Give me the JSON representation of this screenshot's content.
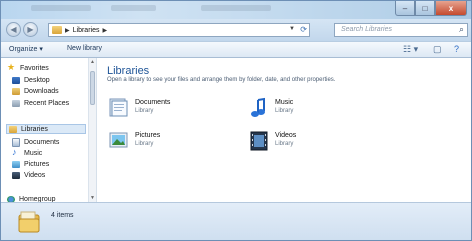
{
  "window": {
    "controls": {
      "minimize": "–",
      "maximize": "□",
      "close": "x"
    }
  },
  "address": {
    "back_glyph": "◀",
    "forward_glyph": "▶",
    "crumb_sep": "▶",
    "crumb": "Libraries",
    "crumb_trail_sep": "▶",
    "dropdown_glyph": "▼",
    "refresh_glyph": "⟳",
    "search_placeholder": "Search Libraries",
    "search_glyph": "⌕"
  },
  "toolbar": {
    "organize": "Organize ▾",
    "new_library": "New library",
    "views_glyph": "☷ ▾",
    "preview_glyph": "▢",
    "help_glyph": "?"
  },
  "nav": {
    "favorites": "Favorites",
    "desktop": "Desktop",
    "downloads": "Downloads",
    "recent": "Recent Places",
    "libraries": "Libraries",
    "documents": "Documents",
    "music": "Music",
    "pictures": "Pictures",
    "videos": "Videos",
    "homegroup": "Homegroup",
    "scroll_up": "▲",
    "scroll_down": "▼"
  },
  "content": {
    "title": "Libraries",
    "subtitle": "Open a library to see your files and arrange them by folder, date, and other properties.",
    "libraries": [
      {
        "name": "Documents",
        "type": "Library",
        "icon": "documents-library-icon"
      },
      {
        "name": "Music",
        "type": "Library",
        "icon": "music-library-icon"
      },
      {
        "name": "Pictures",
        "type": "Library",
        "icon": "pictures-library-icon"
      },
      {
        "name": "Videos",
        "type": "Library",
        "icon": "videos-library-icon"
      }
    ]
  },
  "status": {
    "count": "4 items"
  },
  "colors": {
    "accent_title": "#1e5497",
    "selection": "#dbe9f7"
  }
}
